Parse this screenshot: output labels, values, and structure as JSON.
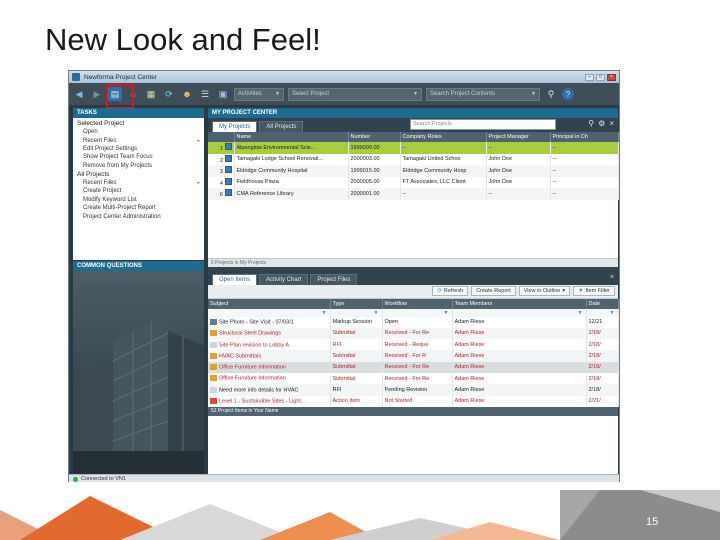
{
  "slide": {
    "title": "New Look and Feel!",
    "page_number": "15"
  },
  "window": {
    "title": "Newforma Project Center"
  },
  "toolbar": {
    "activities_label": "Activities",
    "project_select": "Select Project",
    "search_placeholder": "Search Project Contents"
  },
  "tasks": {
    "header": "TASKS",
    "selected_project_label": "Selected Project",
    "selected_items": [
      "Open",
      "Recent Files",
      "Edit Project Settings",
      "Show Project Team Focus",
      "Remove from My Projects"
    ],
    "all_projects_label": "All Projects",
    "all_items": [
      "Recent Files",
      "Create Project",
      "Modify Keyword List",
      "Create Multi-Project Report",
      "Project Center Administration"
    ]
  },
  "common_questions": {
    "header": "COMMON QUESTIONS"
  },
  "project_center": {
    "header": "MY PROJECT CENTER",
    "tabs": [
      "My Projects",
      "All Projects"
    ],
    "search_placeholder": "Search Projects",
    "columns": [
      "",
      "Name",
      "Number",
      "Company Roles",
      "Project Manager",
      "Principal in Ch"
    ],
    "rows": [
      {
        "num": "1",
        "name": "Alpenglow Environmental Scie...",
        "number": "1999009.00",
        "roles": "--",
        "pm": "--",
        "principal": "--"
      },
      {
        "num": "2",
        "name": "Tamagaki Lodge School Renovati...",
        "number": "2000003.00",
        "roles": "Tamagaki United Schoo",
        "pm": "John Doe",
        "principal": "--"
      },
      {
        "num": "3",
        "name": "Eldridge Community Hospital",
        "number": "1999015.00",
        "roles": "Eldridge Community Hosp",
        "pm": "John Doe",
        "principal": "--"
      },
      {
        "num": "4",
        "name": "Fieldhouse Plaza",
        "number": "2000005.00",
        "roles": "FT Associates, LLC Client",
        "pm": "John Doe",
        "principal": "--"
      },
      {
        "num": "6",
        "name": "CMA Reference Library",
        "number": "2000001.00",
        "roles": "--",
        "pm": "--",
        "principal": "--"
      }
    ],
    "status_text": "5 Projects in My Projects"
  },
  "items_panel": {
    "tabs": [
      "Open Items",
      "Activity Chart",
      "Project Files"
    ],
    "actions": [
      "Refresh",
      "Create Report",
      "View in Outline",
      "Item Filter"
    ],
    "columns": [
      "Subject",
      "Type",
      "Workflow",
      "Team Members",
      "Date"
    ],
    "rows": [
      {
        "subject": "Site Photo - Site Visit - 07/03/1",
        "type": "Markup Session",
        "workflow": "Open",
        "team": "Adam Riese",
        "date": "12/21",
        "red": false
      },
      {
        "subject": "Structural Steel Drawings",
        "type": "Submittal",
        "workflow": "Received - For Re",
        "team": "Adam Riese",
        "date": "2/18/",
        "red": true
      },
      {
        "subject": "Site Plan revision to Lobby A",
        "type": "RFI",
        "workflow": "Received - Reque",
        "team": "Adam Riese",
        "date": "2/18/",
        "red": true
      },
      {
        "subject": "HVAC Submittals",
        "type": "Submittal",
        "workflow": "Received - For R",
        "team": "Adam Riese",
        "date": "2/18/",
        "red": true
      },
      {
        "subject": "Office Furniture Information",
        "type": "Submittal",
        "workflow": "Received - For Re",
        "team": "Adam Riese",
        "date": "2/18/",
        "red": true
      },
      {
        "subject": "Office Furniture Information",
        "type": "Submittal",
        "workflow": "Received - For Re",
        "team": "Adam Riese",
        "date": "2/18/",
        "red": true
      },
      {
        "subject": "Need more info details for HVAC",
        "type": "RFI",
        "workflow": "Pending Revision",
        "team": "Adam Riese",
        "date": "2/18/",
        "red": false
      },
      {
        "subject": "Level 1 - Sustainable Sites - Light...",
        "type": "Action Item",
        "workflow": "Not Started",
        "team": "Adam Riese",
        "date": "2/21/",
        "red": true
      }
    ],
    "footer": "52 Project Items in Your Name"
  },
  "statusbar": {
    "text": "Connected to VN1"
  }
}
